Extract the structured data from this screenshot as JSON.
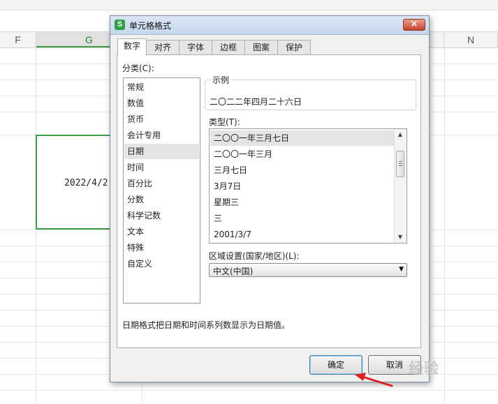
{
  "sheet": {
    "columns": [
      {
        "label": "F",
        "selected": false
      },
      {
        "label": "G",
        "selected": true
      },
      {
        "label": "N",
        "selected": false
      }
    ],
    "cell_value": "2022/4/2",
    "accent": "#3f9c45"
  },
  "dialog": {
    "app_icon_glyph": "S",
    "title": "单元格格式",
    "close_glyph": "×",
    "tabs": [
      {
        "label": "数字",
        "active": true
      },
      {
        "label": "对齐",
        "active": false
      },
      {
        "label": "字体",
        "active": false
      },
      {
        "label": "边框",
        "active": false
      },
      {
        "label": "图案",
        "active": false
      },
      {
        "label": "保护",
        "active": false
      }
    ],
    "category_label": "分类(C):",
    "categories": [
      {
        "label": "常规",
        "selected": false
      },
      {
        "label": "数值",
        "selected": false
      },
      {
        "label": "货币",
        "selected": false
      },
      {
        "label": "会计专用",
        "selected": false
      },
      {
        "label": "日期",
        "selected": true
      },
      {
        "label": "时间",
        "selected": false
      },
      {
        "label": "百分比",
        "selected": false
      },
      {
        "label": "分数",
        "selected": false
      },
      {
        "label": "科学记数",
        "selected": false
      },
      {
        "label": "文本",
        "selected": false
      },
      {
        "label": "特殊",
        "selected": false
      },
      {
        "label": "自定义",
        "selected": false
      }
    ],
    "sample_label": "示例",
    "sample_value": "二〇二二年四月二十六日",
    "type_label": "类型(T):",
    "types": [
      {
        "label": "二〇〇一年三月七日",
        "selected": true
      },
      {
        "label": "二〇〇一年三月",
        "selected": false
      },
      {
        "label": "三月七日",
        "selected": false
      },
      {
        "label": "3月7日",
        "selected": false
      },
      {
        "label": "星期三",
        "selected": false
      },
      {
        "label": "三",
        "selected": false
      },
      {
        "label": "2001/3/7",
        "selected": false
      }
    ],
    "locale_label": "区域设置(国家/地区)(L):",
    "locale_value": "中文(中国)",
    "description": "日期格式把日期和时间系列数显示为日期值。",
    "ok_label": "确定",
    "cancel_label": "取消"
  },
  "watermark": "经验"
}
